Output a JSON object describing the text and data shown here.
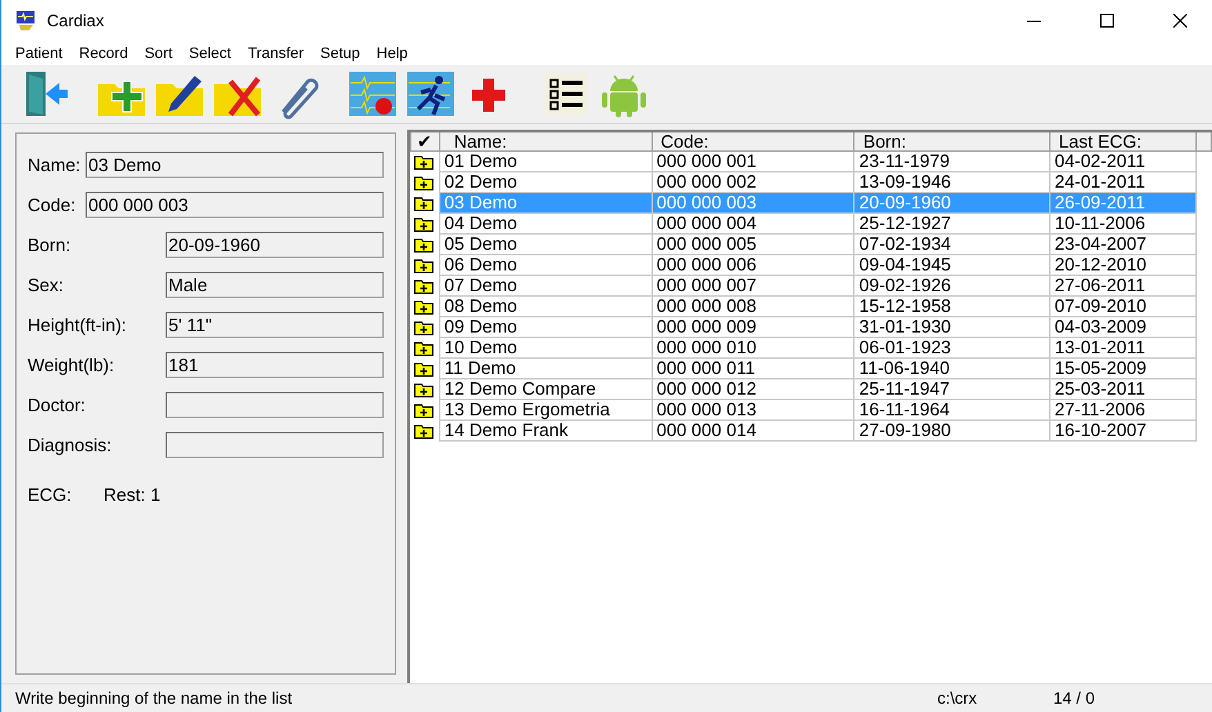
{
  "window": {
    "title": "Cardiax"
  },
  "menu": [
    "Patient",
    "Record",
    "Sort",
    "Select",
    "Transfer",
    "Setup",
    "Help"
  ],
  "patient_form": {
    "fields": [
      {
        "kind": "inline",
        "label": "Name:",
        "value": "03 Demo"
      },
      {
        "kind": "inline",
        "label": "Code:",
        "value": "000 000 003"
      },
      {
        "kind": "column",
        "label": "Born:",
        "value": "20-09-1960"
      },
      {
        "kind": "column",
        "label": "Sex:",
        "value": "Male"
      },
      {
        "kind": "column",
        "label": "Height(ft-in):",
        "value": "5' 11\""
      },
      {
        "kind": "column",
        "label": "Weight(lb):",
        "value": "181"
      },
      {
        "kind": "column",
        "label": "Doctor:"
      },
      {
        "kind": "column",
        "label": "Diagnosis:"
      }
    ],
    "ecg_label": "ECG:",
    "ecg_value": "Rest: 1"
  },
  "table": {
    "check_header": "✔",
    "columns": [
      "Name:",
      "Code:",
      "Born:",
      "Last ECG:"
    ],
    "rows": [
      {
        "cells": [
          "01 Demo",
          "000 000 001",
          "23-11-1979",
          "04-02-2011"
        ],
        "selected": false
      },
      {
        "cells": [
          "02 Demo",
          "000 000 002",
          "13-09-1946",
          "24-01-2011"
        ],
        "selected": false
      },
      {
        "cells": [
          "03 Demo",
          "000 000 003",
          "20-09-1960",
          "26-09-2011"
        ],
        "selected": true
      },
      {
        "cells": [
          "04 Demo",
          "000 000 004",
          "25-12-1927",
          "10-11-2006"
        ],
        "selected": false
      },
      {
        "cells": [
          "05 Demo",
          "000 000 005",
          "07-02-1934",
          "23-04-2007"
        ],
        "selected": false
      },
      {
        "cells": [
          "06 Demo",
          "000 000 006",
          "09-04-1945",
          "20-12-2010"
        ],
        "selected": false
      },
      {
        "cells": [
          "07 Demo",
          "000 000 007",
          "09-02-1926",
          "27-06-2011"
        ],
        "selected": false
      },
      {
        "cells": [
          "08 Demo",
          "000 000 008",
          "15-12-1958",
          "07-09-2010"
        ],
        "selected": false
      },
      {
        "cells": [
          "09 Demo",
          "000 000 009",
          "31-01-1930",
          "04-03-2009"
        ],
        "selected": false
      },
      {
        "cells": [
          "10 Demo",
          "000 000 010",
          "06-01-1923",
          "13-01-2011"
        ],
        "selected": false
      },
      {
        "cells": [
          "11 Demo",
          "000 000 011",
          "11-06-1940",
          "15-05-2009"
        ],
        "selected": false
      },
      {
        "cells": [
          "12 Demo Compare",
          "000 000 012",
          "25-11-1947",
          "25-03-2011"
        ],
        "selected": false
      },
      {
        "cells": [
          "13 Demo Ergometria",
          "000 000 013",
          "16-11-1964",
          "27-11-2006"
        ],
        "selected": false
      },
      {
        "cells": [
          "14 Demo Frank",
          "000 000 014",
          "27-09-1980",
          "16-10-2007"
        ],
        "selected": false
      }
    ]
  },
  "status_bar": {
    "message": "Write beginning of the name in the list",
    "path": "c:\\crx",
    "count": "14 / 0"
  }
}
